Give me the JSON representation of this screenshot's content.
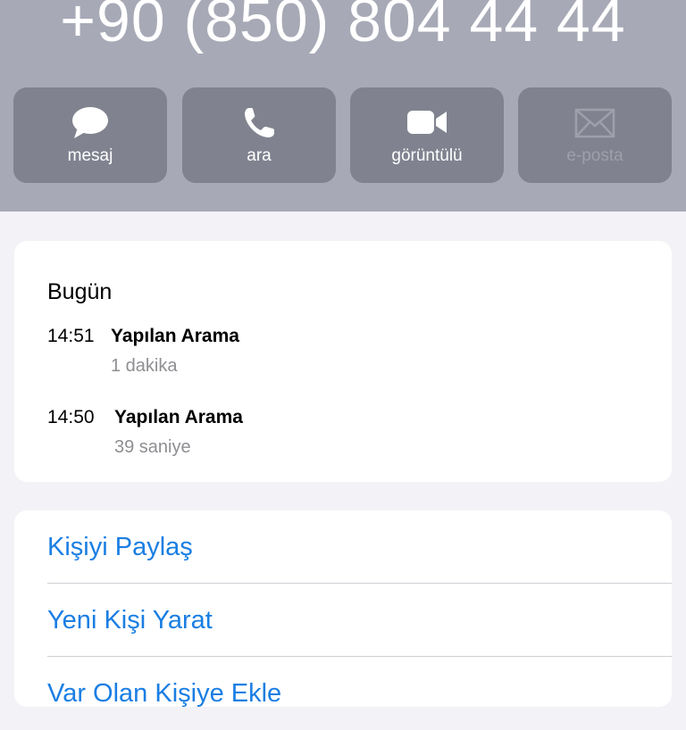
{
  "contact": {
    "phone_number": "+90 (850) 804 44 44"
  },
  "actions": [
    {
      "label": "mesaj",
      "icon": "message-bubble-icon",
      "enabled": true
    },
    {
      "label": "ara",
      "icon": "phone-icon",
      "enabled": true
    },
    {
      "label": "görüntülü",
      "icon": "video-camera-icon",
      "enabled": true
    },
    {
      "label": "e-posta",
      "icon": "envelope-icon",
      "enabled": false
    }
  ],
  "call_history": {
    "day": "Bugün",
    "calls": [
      {
        "time": "14:51",
        "type": "Yapılan Arama",
        "duration": "1 dakika"
      },
      {
        "time": "14:50",
        "type": "Yapılan Arama",
        "duration": "39 saniye"
      }
    ]
  },
  "contact_actions": [
    {
      "label": "Kişiyi Paylaş"
    },
    {
      "label": "Yeni Kişi Yarat"
    },
    {
      "label": "Var Olan Kişiye Ekle"
    }
  ],
  "colors": {
    "header_background": "#a7a9b6",
    "action_button_background": "#80838f",
    "link_blue": "#1a7ee3",
    "secondary_text": "#8e8e93",
    "page_background": "#f2f2f7"
  }
}
